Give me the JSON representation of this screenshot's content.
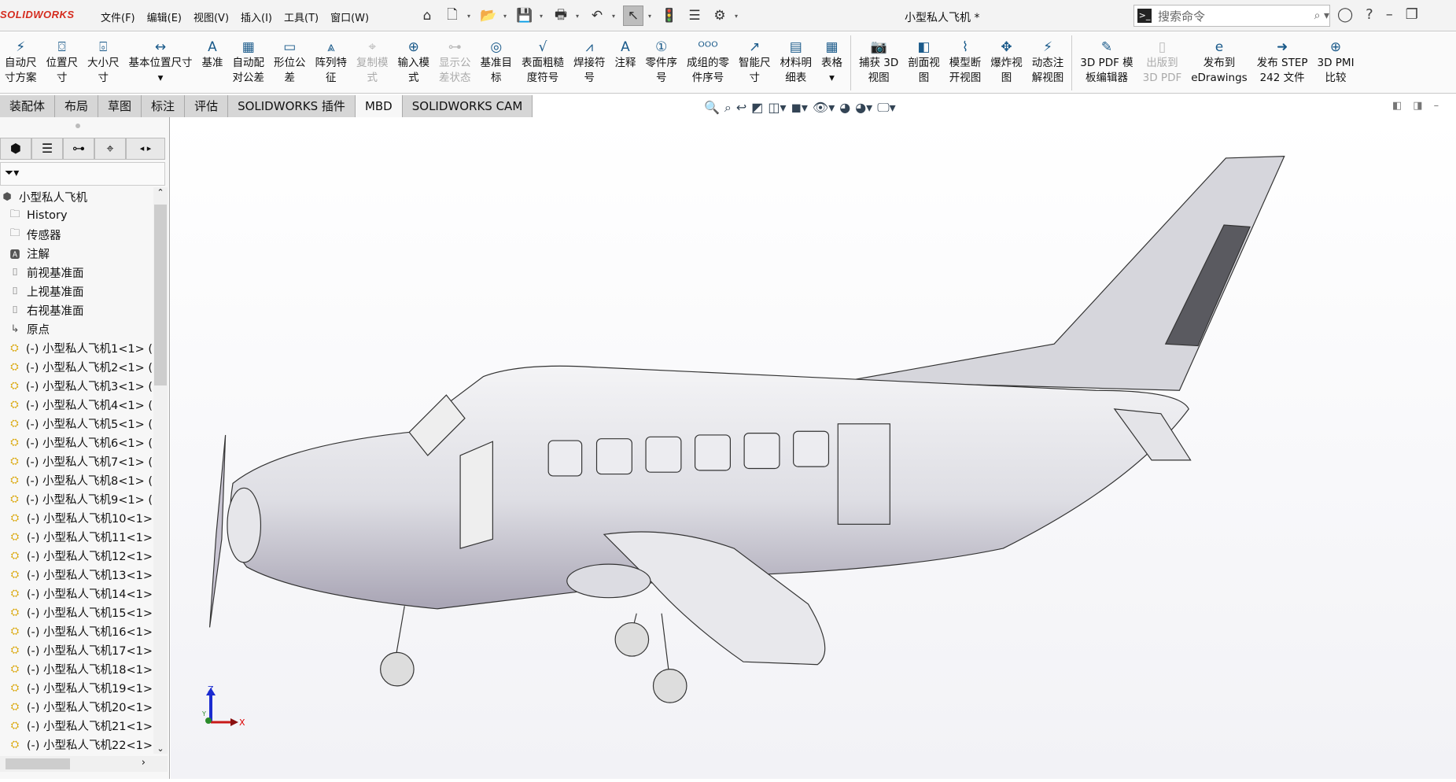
{
  "app": {
    "logo": "SOLIDWORKS",
    "title": "小型私人飞机 *"
  },
  "menu": [
    "文件(F)",
    "编辑(E)",
    "视图(V)",
    "插入(I)",
    "工具(T)",
    "窗口(W)"
  ],
  "search": {
    "placeholder": "搜索命令"
  },
  "quick_access": [
    "home-icon",
    "new-document-icon",
    "open-icon",
    "save-icon",
    "print-icon",
    "undo-icon",
    "select-icon",
    "rebuild-icon",
    "file-properties-icon",
    "options-icon"
  ],
  "commands": [
    {
      "l1": "自动尺",
      "l2": "寸方案",
      "icon": "⚡",
      "enabled": true
    },
    {
      "l1": "位置尺",
      "l2": "寸",
      "icon": "⌼",
      "enabled": true
    },
    {
      "l1": "大小尺",
      "l2": "寸",
      "icon": "⌻",
      "enabled": true
    },
    {
      "l1": "基本位置尺寸",
      "l2": "▾",
      "icon": "↔",
      "enabled": true
    },
    {
      "l1": "基准",
      "l2": "",
      "icon": "A",
      "enabled": true
    },
    {
      "l1": "自动配",
      "l2": "对公差",
      "icon": "▦",
      "enabled": true
    },
    {
      "l1": "形位公",
      "l2": "差",
      "icon": "▭",
      "enabled": true
    },
    {
      "l1": "阵列特",
      "l2": "征",
      "icon": "⩓",
      "enabled": true
    },
    {
      "l1": "复制模",
      "l2": "式",
      "icon": "⌖",
      "enabled": false
    },
    {
      "l1": "输入模",
      "l2": "式",
      "icon": "⊕",
      "enabled": true
    },
    {
      "l1": "显示公",
      "l2": "差状态",
      "icon": "⊶",
      "enabled": false
    },
    {
      "l1": "基准目",
      "l2": "标",
      "icon": "◎",
      "enabled": true
    },
    {
      "l1": "表面粗糙",
      "l2": "度符号",
      "icon": "√",
      "enabled": true
    },
    {
      "l1": "焊接符",
      "l2": "号",
      "icon": "⩘",
      "enabled": true
    },
    {
      "l1": "注释",
      "l2": "",
      "icon": "A",
      "enabled": true
    },
    {
      "l1": "零件序",
      "l2": "号",
      "icon": "①",
      "enabled": true
    },
    {
      "l1": "成组的零",
      "l2": "件序号",
      "icon": "ᴼᴼᴼ",
      "enabled": true
    },
    {
      "l1": "智能尺",
      "l2": "寸",
      "icon": "↗",
      "enabled": true
    },
    {
      "l1": "材料明",
      "l2": "细表",
      "icon": "▤",
      "enabled": true
    },
    {
      "l1": "表格",
      "l2": "▾",
      "icon": "▦",
      "enabled": true
    },
    {
      "sep": true
    },
    {
      "l1": "捕获 3D",
      "l2": "视图",
      "icon": "📷",
      "enabled": true
    },
    {
      "l1": "剖面视",
      "l2": "图",
      "icon": "◧",
      "enabled": true
    },
    {
      "l1": "模型断",
      "l2": "开视图",
      "icon": "⌇",
      "enabled": true
    },
    {
      "l1": "爆炸视",
      "l2": "图",
      "icon": "✥",
      "enabled": true
    },
    {
      "l1": "动态注",
      "l2": "解视图",
      "icon": "⚡",
      "enabled": true
    },
    {
      "sep": true
    },
    {
      "l1": "3D PDF 模",
      "l2": "板编辑器",
      "icon": "✎",
      "enabled": true
    },
    {
      "l1": "出版到",
      "l2": "3D PDF",
      "icon": "▯",
      "enabled": false
    },
    {
      "l1": "发布到",
      "l2": "eDrawings",
      "icon": "e",
      "enabled": true
    },
    {
      "l1": "发布 STEP",
      "l2": "242 文件",
      "icon": "➜",
      "enabled": true
    },
    {
      "l1": "3D PMI",
      "l2": "比较",
      "icon": "⊕",
      "enabled": true
    }
  ],
  "tabs": [
    {
      "label": "装配体",
      "active": false
    },
    {
      "label": "布局",
      "active": false
    },
    {
      "label": "草图",
      "active": false
    },
    {
      "label": "标注",
      "active": false
    },
    {
      "label": "评估",
      "active": false
    },
    {
      "label": "SOLIDWORKS 插件",
      "active": false
    },
    {
      "label": "MBD",
      "active": true
    },
    {
      "label": "SOLIDWORKS CAM",
      "active": false
    }
  ],
  "panel_tabs": [
    "featuremanager-icon",
    "propertymanager-icon",
    "configurationmanager-icon",
    "dimxpert-icon",
    "display-manager-icon"
  ],
  "tree": [
    {
      "label": "小型私人飞机",
      "icon": "assembly"
    },
    {
      "label": "History",
      "icon": "history"
    },
    {
      "label": "传感器",
      "icon": "sensor"
    },
    {
      "label": "注解",
      "icon": "annotation"
    },
    {
      "label": "前视基准面",
      "icon": "plane"
    },
    {
      "label": "上视基准面",
      "icon": "plane"
    },
    {
      "label": "右视基准面",
      "icon": "plane"
    },
    {
      "label": "原点",
      "icon": "origin"
    },
    {
      "label": "(-) 小型私人飞机1<1> (",
      "icon": "part"
    },
    {
      "label": "(-) 小型私人飞机2<1> (",
      "icon": "part"
    },
    {
      "label": "(-) 小型私人飞机3<1> (",
      "icon": "part"
    },
    {
      "label": "(-) 小型私人飞机4<1> (",
      "icon": "part"
    },
    {
      "label": "(-) 小型私人飞机5<1> (",
      "icon": "part"
    },
    {
      "label": "(-) 小型私人飞机6<1> (",
      "icon": "part"
    },
    {
      "label": "(-) 小型私人飞机7<1> (",
      "icon": "part"
    },
    {
      "label": "(-) 小型私人飞机8<1> (",
      "icon": "part"
    },
    {
      "label": "(-) 小型私人飞机9<1> (",
      "icon": "part"
    },
    {
      "label": "(-) 小型私人飞机10<1>",
      "icon": "part"
    },
    {
      "label": "(-) 小型私人飞机11<1>",
      "icon": "part"
    },
    {
      "label": "(-) 小型私人飞机12<1>",
      "icon": "part"
    },
    {
      "label": "(-) 小型私人飞机13<1>",
      "icon": "part"
    },
    {
      "label": "(-) 小型私人飞机14<1>",
      "icon": "part"
    },
    {
      "label": "(-) 小型私人飞机15<1>",
      "icon": "part"
    },
    {
      "label": "(-) 小型私人飞机16<1>",
      "icon": "part"
    },
    {
      "label": "(-) 小型私人飞机17<1>",
      "icon": "part"
    },
    {
      "label": "(-) 小型私人飞机18<1>",
      "icon": "part"
    },
    {
      "label": "(-) 小型私人飞机19<1>",
      "icon": "part"
    },
    {
      "label": "(-) 小型私人飞机20<1>",
      "icon": "part"
    },
    {
      "label": "(-) 小型私人飞机21<1>",
      "icon": "part"
    },
    {
      "label": "(-) 小型私人飞机22<1>",
      "icon": "part"
    }
  ],
  "triad": {
    "x": "X",
    "y": "Y",
    "z": "Z"
  },
  "colors": {
    "brand": "#d52b1e",
    "part_icon": "#d9a400",
    "model": "#dcdce2"
  }
}
